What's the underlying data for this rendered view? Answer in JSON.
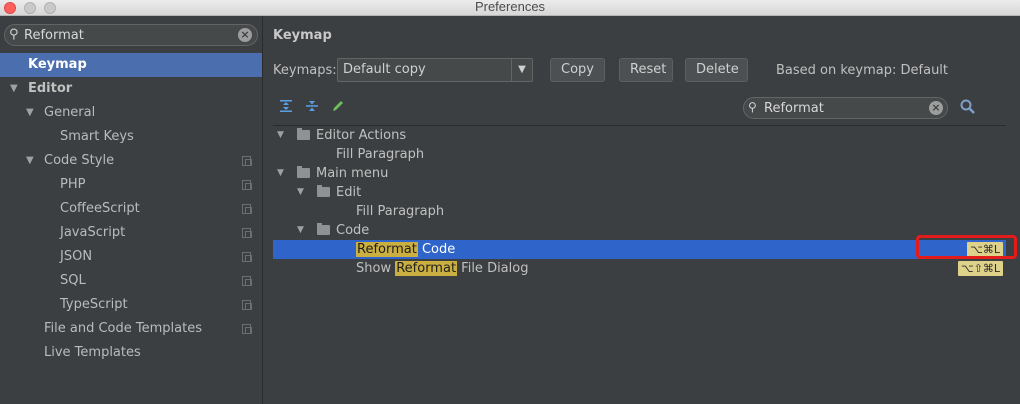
{
  "window": {
    "title": "Preferences"
  },
  "sidebar": {
    "search_value": "Reformat",
    "items": [
      {
        "label": "Keymap"
      },
      {
        "label": "Editor"
      },
      {
        "label": "General"
      },
      {
        "label": "Smart Keys"
      },
      {
        "label": "Code Style"
      },
      {
        "label": "PHP"
      },
      {
        "label": "CoffeeScript"
      },
      {
        "label": "JavaScript"
      },
      {
        "label": "JSON"
      },
      {
        "label": "SQL"
      },
      {
        "label": "TypeScript"
      },
      {
        "label": "File and Code Templates"
      },
      {
        "label": "Live Templates"
      }
    ]
  },
  "main": {
    "title": "Keymap",
    "keymaps_label": "Keymaps:",
    "keymap_selected": "Default copy",
    "copy_label": "Copy",
    "reset_label": "Reset",
    "delete_label": "Delete",
    "based_on": "Based on keymap: Default",
    "search_value": "Reformat",
    "tree": {
      "editor_actions": "Editor Actions",
      "fill_paragraph_1": "Fill Paragraph",
      "main_menu": "Main menu",
      "edit": "Edit",
      "fill_paragraph_2": "Fill Paragraph",
      "code": "Code",
      "reformat_code_hl": "Reformat",
      "reformat_code_rest": " Code",
      "reformat_code_shortcut": "⌥⌘L",
      "show_prefix": "Show ",
      "show_hl": "Reformat",
      "show_rest": " File Dialog",
      "show_shortcut": "⌥⇧⌘L"
    }
  }
}
